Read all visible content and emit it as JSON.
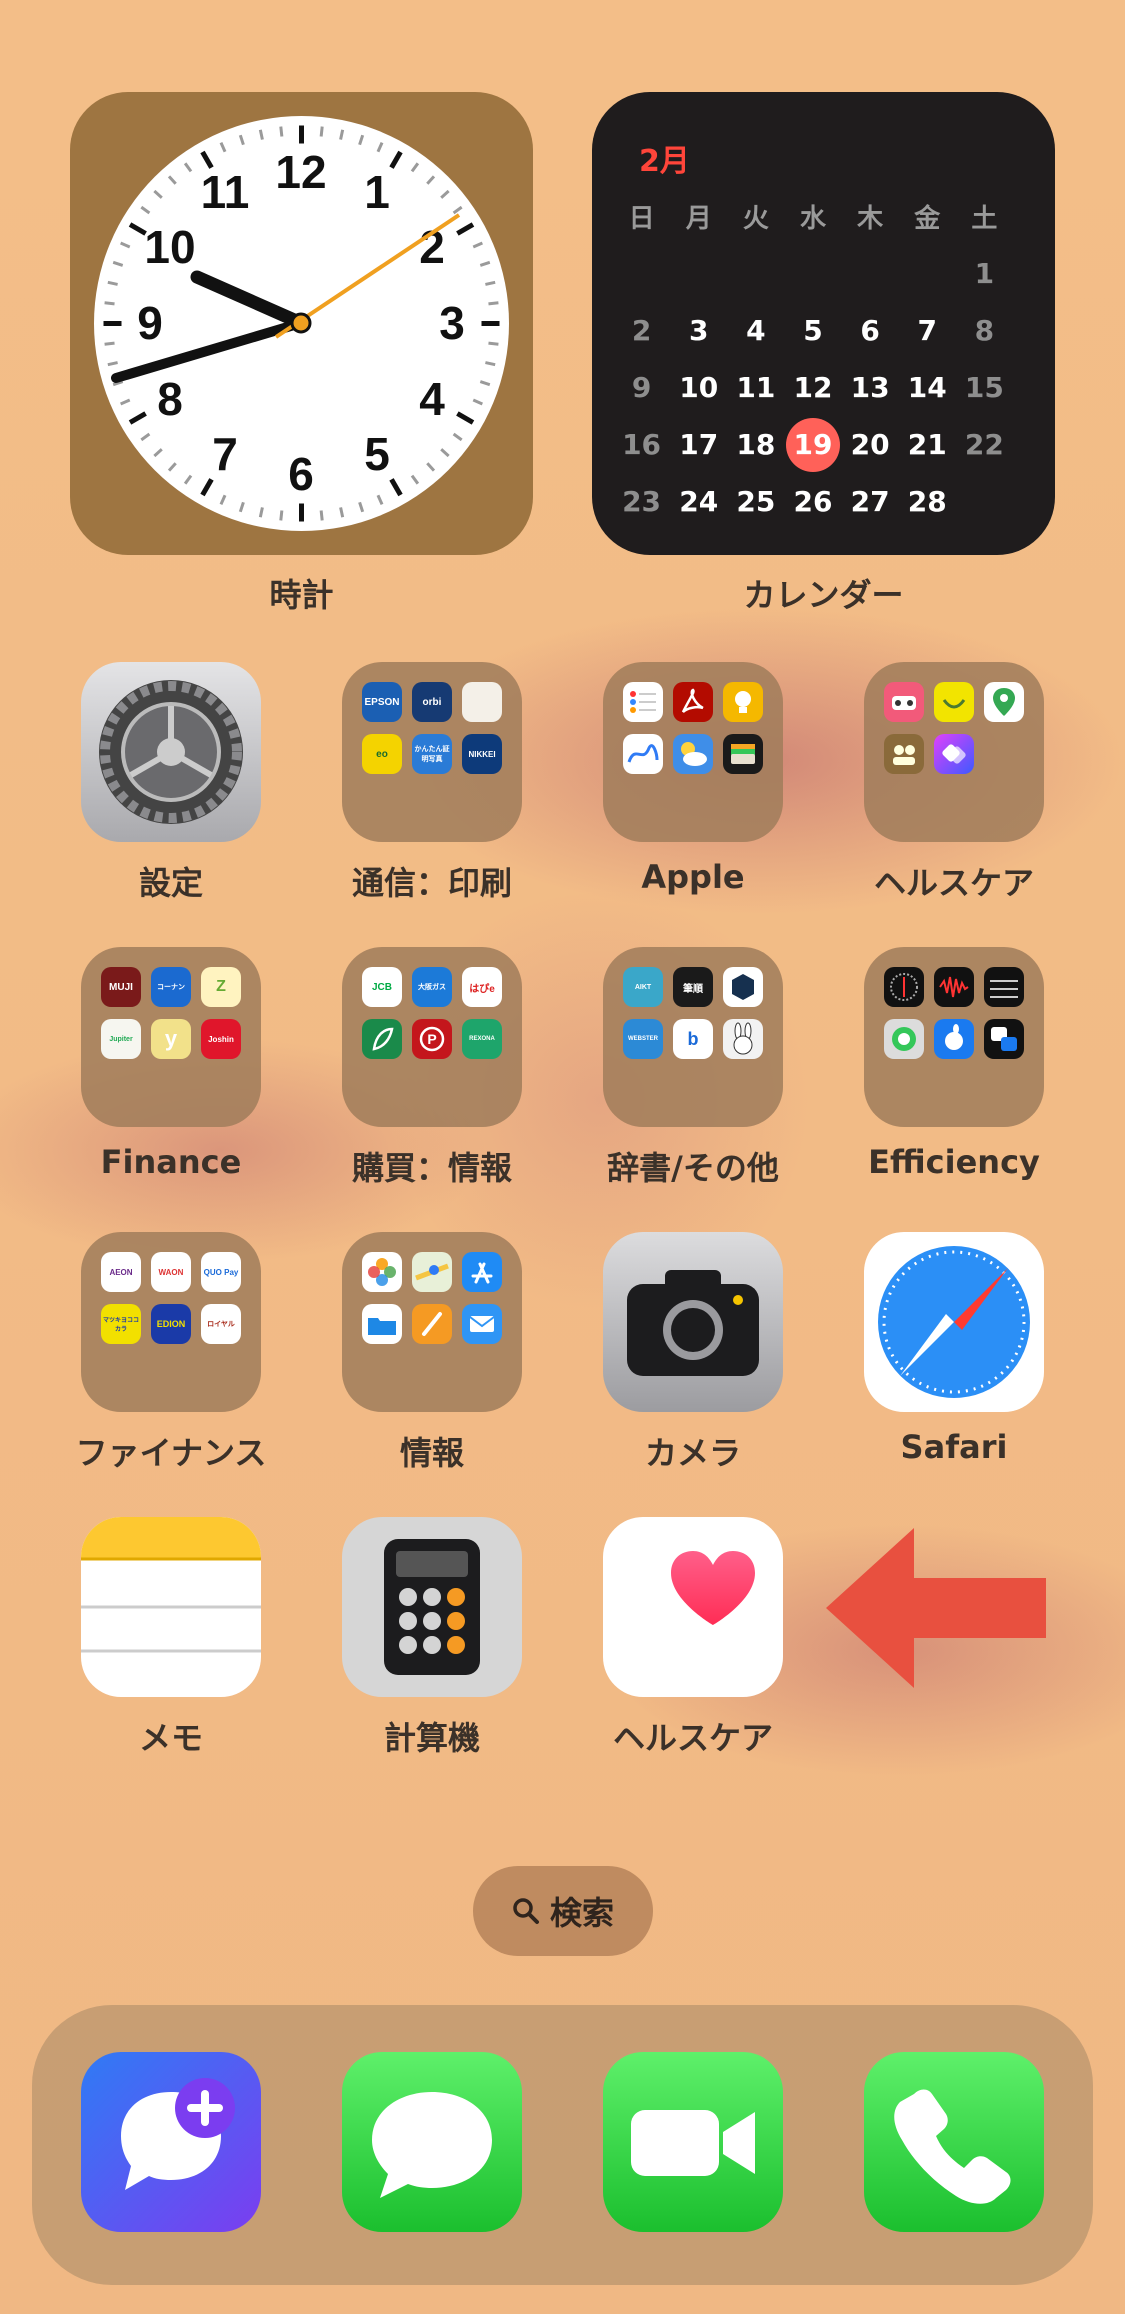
{
  "widgets": {
    "clock": {
      "label": "時計",
      "numbers": [
        "12",
        "1",
        "2",
        "3",
        "4",
        "5",
        "6",
        "7",
        "8",
        "9",
        "10",
        "11"
      ],
      "time": "9:41"
    },
    "calendar": {
      "label": "カレンダー",
      "month": "2月",
      "weekdays": [
        "日",
        "月",
        "火",
        "水",
        "木",
        "金",
        "土"
      ],
      "weeks": [
        [
          "",
          "",
          "",
          "",
          "",
          "",
          "1"
        ],
        [
          "2",
          "3",
          "4",
          "5",
          "6",
          "7",
          "8"
        ],
        [
          "9",
          "10",
          "11",
          "12",
          "13",
          "14",
          "15"
        ],
        [
          "16",
          "17",
          "18",
          "19",
          "20",
          "21",
          "22"
        ],
        [
          "23",
          "24",
          "25",
          "26",
          "27",
          "28",
          ""
        ]
      ],
      "today": "19"
    }
  },
  "apps": [
    {
      "label": "設定",
      "icon": "settings-gear-icon"
    },
    {
      "label": "通信：印刷",
      "icon": "folder-icon",
      "minis": [
        "EPSON",
        "orbi",
        "",
        "eo",
        "かんたん証明写真",
        "NIKKEI"
      ]
    },
    {
      "label": "Apple",
      "icon": "folder-icon",
      "minis": [
        "",
        "",
        "",
        "",
        "",
        ""
      ]
    },
    {
      "label": "ヘルスケア",
      "icon": "folder-icon",
      "minis": [
        "",
        "",
        "",
        "",
        "",
        ""
      ]
    },
    {
      "label": "Finance",
      "icon": "folder-icon",
      "minis": [
        "MUJI",
        "コーナン",
        "Z",
        "Jupiter",
        "y",
        "Joshin"
      ]
    },
    {
      "label": "購買：情報",
      "icon": "folder-icon",
      "minis": [
        "JCB",
        "大阪ガス",
        "はぴe",
        "",
        "",
        "REXONA"
      ]
    },
    {
      "label": "辞書/その他",
      "icon": "folder-icon",
      "minis": [
        "AIKT",
        "筆順",
        "",
        "WEBSTER",
        "b",
        ""
      ]
    },
    {
      "label": "Efficiency",
      "icon": "folder-icon",
      "minis": [
        "",
        "",
        "",
        "",
        "",
        ""
      ]
    },
    {
      "label": "ファイナンス",
      "icon": "folder-icon",
      "minis": [
        "AEON",
        "WAON",
        "QUO Pay",
        "マツキヨココカラ",
        "EDION",
        "ロイヤル"
      ]
    },
    {
      "label": "情報",
      "icon": "folder-icon",
      "minis": [
        "",
        "",
        "",
        "",
        "",
        ""
      ]
    },
    {
      "label": "カメラ",
      "icon": "camera-icon"
    },
    {
      "label": "Safari",
      "icon": "compass-icon"
    },
    {
      "label": "メモ",
      "icon": "notes-icon"
    },
    {
      "label": "計算機",
      "icon": "calculator-icon"
    },
    {
      "label": "ヘルスケア",
      "icon": "heart-icon"
    }
  ],
  "search": {
    "label": "検索"
  },
  "dock": [
    {
      "icon": "chat-plus-icon"
    },
    {
      "icon": "messages-icon"
    },
    {
      "icon": "facetime-icon"
    },
    {
      "icon": "phone-icon"
    }
  ],
  "annotation": {
    "arrow_color": "#e8503f"
  }
}
